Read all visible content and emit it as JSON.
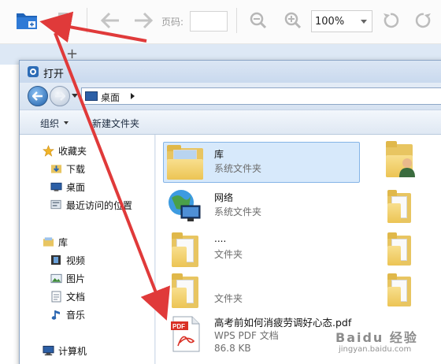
{
  "toolbar": {
    "page_label": "页码:",
    "page_value": "",
    "zoom_value": "100%"
  },
  "tabs": {
    "add_label": "+"
  },
  "dialog": {
    "title": "打开",
    "address": "桌面",
    "commands": {
      "organize": "组织",
      "new_folder": "新建文件夹"
    },
    "nav": {
      "favorites": "收藏夹",
      "downloads": "下载",
      "desktop": "桌面",
      "recent": "最近访问的位置",
      "libraries": "库",
      "videos": "视频",
      "pictures": "图片",
      "documents": "文档",
      "music": "音乐",
      "computer": "计算机"
    },
    "items": [
      {
        "name": "库",
        "type": "系统文件夹"
      },
      {
        "name": "网络",
        "type": "系统文件夹"
      },
      {
        "name": "....",
        "type": "文件夹"
      },
      {
        "name": "",
        "type": "文件夹"
      },
      {
        "name": "高考前如何消疲劳调好心态.pdf",
        "type": "WPS PDF 文档",
        "size": "86.8 KB"
      }
    ]
  },
  "watermark": {
    "main": "Baidu 经验",
    "sub": "jingyan.baidu.com"
  },
  "colors": {
    "accent": "#1f63b8",
    "arrow": "#e03a3a",
    "selection": "#d7e9fb"
  }
}
